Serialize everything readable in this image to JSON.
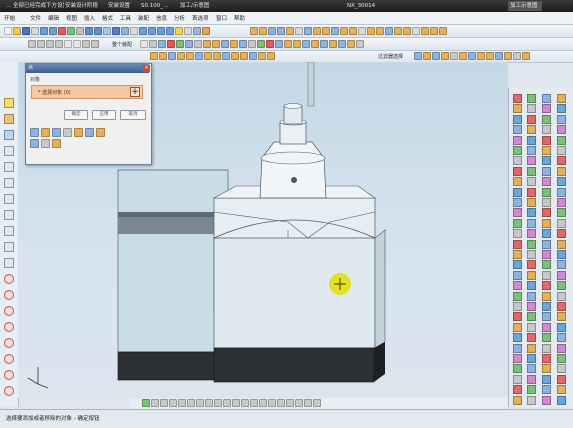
{
  "taskbar": {
    "tabs": [
      "... 全部已经完成下方设置",
      "安装设计阶段",
      "安装设置",
      "S0.100_...",
      "加工/示意图",
      "NX_30014"
    ],
    "window_title": "加工示意图"
  },
  "menu": [
    "开始",
    "文件",
    "编辑",
    "视图",
    "插入",
    "格式",
    "工具",
    "装配",
    "信息",
    "分析",
    "首选项",
    "窗口",
    "帮助"
  ],
  "toolbar": {
    "row3_label": "整个装配",
    "row4_label": "过滤器选择"
  },
  "dialog": {
    "title": "点",
    "group_label": "对象",
    "select_label": "* 选择对象 (0)",
    "ok_label": "确定",
    "apply_label": "应用",
    "cancel_label": "取消"
  },
  "status": {
    "text": "选择要添加或者移除的对象 - 确定按钮"
  },
  "colors": {
    "viewport_bg": "#c8dae8",
    "part_face": "#dde8ef",
    "base_dark": "#2a2d30",
    "cursor_marker": "#e0e010",
    "dialog_select": "#f5c7a3"
  },
  "icons": [
    "new-icon",
    "open-icon",
    "save-icon",
    "cut-icon",
    "undo-icon",
    "redo-icon",
    "fit-icon",
    "zoom-icon",
    "rotate-icon",
    "shaded-icon",
    "wireframe-icon",
    "layer-icon",
    "point-icon",
    "line-icon",
    "arc-icon",
    "circle-icon",
    "snap-icon",
    "crosshair-icon"
  ]
}
